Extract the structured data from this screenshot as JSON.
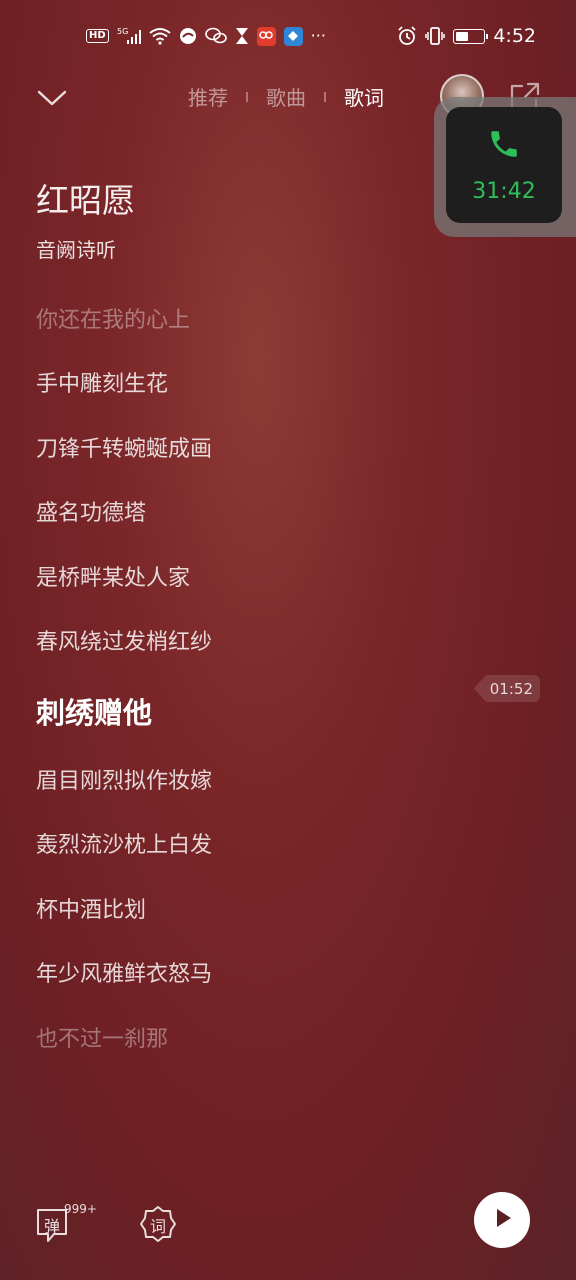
{
  "status_bar": {
    "left_icons": [
      "HD",
      "5G",
      "wifi-icon",
      "browser-icon",
      "wechat-icon",
      "hourglass-icon",
      "app-red-icon",
      "app-blue-icon",
      "more-icon"
    ],
    "hd_label": "HD",
    "net_label": "5G",
    "more_label": "···",
    "time": "4:52",
    "battery_level": 0.45
  },
  "top_nav": {
    "tabs": [
      {
        "label": "推荐",
        "active": false
      },
      {
        "label": "歌曲",
        "active": false
      },
      {
        "label": "歌词",
        "active": true
      }
    ]
  },
  "call_float": {
    "timer": "31:42",
    "accent": "#2fbf5a"
  },
  "song": {
    "title": "红昭愿",
    "artist": "音阙诗听"
  },
  "lyrics": [
    {
      "text": "你还在我的心上",
      "state": "dim"
    },
    {
      "text": "手中雕刻生花",
      "state": "normal"
    },
    {
      "text": "刀锋千转蜿蜒成画",
      "state": "normal"
    },
    {
      "text": "盛名功德塔",
      "state": "normal"
    },
    {
      "text": "是桥畔某处人家",
      "state": "normal"
    },
    {
      "text": "春风绕过发梢红纱",
      "state": "normal"
    },
    {
      "text": "刺绣赠他",
      "state": "current"
    },
    {
      "text": "眉目刚烈拟作妆嫁",
      "state": "normal"
    },
    {
      "text": "轰烈流沙枕上白发",
      "state": "normal"
    },
    {
      "text": "杯中酒比划",
      "state": "normal"
    },
    {
      "text": "年少风雅鲜衣怒马",
      "state": "normal"
    },
    {
      "text": "也不过一刹那",
      "state": "dim"
    }
  ],
  "seek_time": "01:52",
  "bottom_bar": {
    "danmu_label": "弹",
    "danmu_count": "999+",
    "lyric_label": "词"
  },
  "colors": {
    "background": "#7a2629",
    "call_timer": "#2fbf5a"
  }
}
